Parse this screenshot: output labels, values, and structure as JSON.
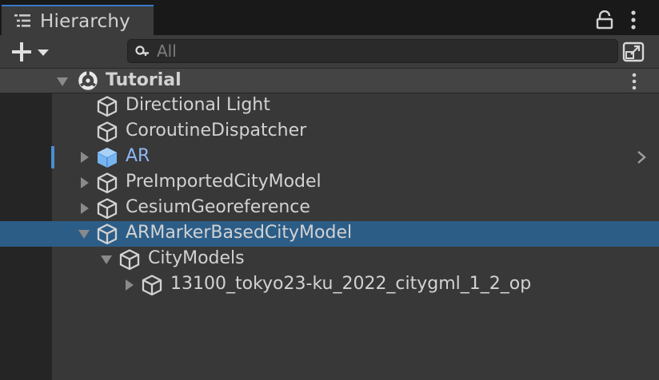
{
  "window": {
    "tab_title": "Hierarchy",
    "tab_icon": "hierarchy-list-icon",
    "lock_icon": "lock-icon",
    "menu_icon": "kebab-menu-icon"
  },
  "toolbar": {
    "create_icon": "plus-dropdown-icon",
    "search_placeholder": "All",
    "search_icon": "search-icon",
    "popout_icon": "popout-icon"
  },
  "scene": {
    "name": "Tutorial",
    "icon": "unity-scene-icon",
    "expanded": true
  },
  "items": [
    {
      "label": "Directional Light",
      "depth": 1,
      "fold": "none",
      "selected": false,
      "highlighted": false
    },
    {
      "label": "CoroutineDispatcher",
      "depth": 1,
      "fold": "none",
      "selected": false,
      "highlighted": false
    },
    {
      "label": "AR",
      "depth": 1,
      "fold": "collapsed",
      "selected": false,
      "highlighted": true
    },
    {
      "label": "PreImportedCityModel",
      "depth": 1,
      "fold": "collapsed",
      "selected": false,
      "highlighted": false
    },
    {
      "label": "CesiumGeoreference",
      "depth": 1,
      "fold": "collapsed",
      "selected": false,
      "highlighted": false
    },
    {
      "label": "ARMarkerBasedCityModel",
      "depth": 1,
      "fold": "expanded",
      "selected": true,
      "highlighted": false
    },
    {
      "label": "CityModels",
      "depth": 2,
      "fold": "expanded",
      "selected": false,
      "highlighted": false
    },
    {
      "label": "13100_tokyo23-ku_2022_citygml_1_2_op",
      "depth": 3,
      "fold": "collapsed",
      "selected": false,
      "highlighted": false
    }
  ],
  "colors": {
    "selected_row": "#2c5d87",
    "prefab_blue": "#8eb6f5",
    "accent": "#3a7acc"
  }
}
